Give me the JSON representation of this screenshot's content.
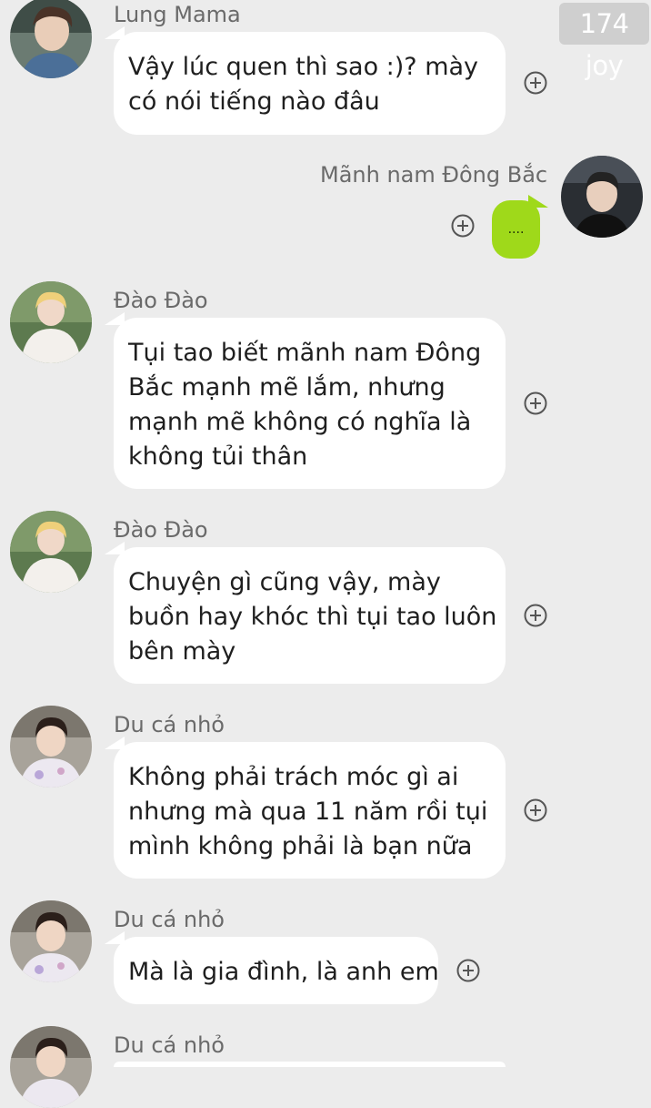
{
  "watermark": "174 joy",
  "messages": [
    {
      "sender": "Lung Mama",
      "avatar": "avatar-lung-mama",
      "lines": [
        "Vậy lúc quen thì sao :)? mày",
        "có nói tiếng nào đâu"
      ]
    },
    {
      "sender": "Mãnh nam Đông Bắc",
      "avatar": "avatar-manh-nam",
      "lines": [
        "...."
      ],
      "self": true
    },
    {
      "sender": "Đào Đào",
      "avatar": "avatar-dao-dao",
      "lines": [
        "Tụi tao biết mãnh nam Đông",
        "Bắc mạnh mẽ lắm, nhưng",
        "mạnh mẽ không có nghĩa là",
        "không tủi thân"
      ]
    },
    {
      "sender": "Đào Đào",
      "avatar": "avatar-dao-dao",
      "lines": [
        "Chuyện gì cũng vậy, mày",
        "buồn hay khóc thì tụi tao luôn",
        "bên mày"
      ]
    },
    {
      "sender": "Du cá nhỏ",
      "avatar": "avatar-du-ca-nho",
      "lines": [
        "Không phải trách móc gì ai",
        "nhưng mà qua 11 năm rồi tụi",
        "mình không phải là bạn nữa"
      ]
    },
    {
      "sender": "Du cá nhỏ",
      "avatar": "avatar-du-ca-nho",
      "lines": [
        "Mà là gia đình, là anh em"
      ]
    },
    {
      "sender": "Du cá nhỏ",
      "avatar": "avatar-du-ca-nho",
      "lines": []
    }
  ],
  "icons": {
    "add": "plus-circle-icon"
  },
  "colors": {
    "background": "#ececec",
    "bubble_other": "#ffffff",
    "bubble_self": "#9fd91a"
  }
}
